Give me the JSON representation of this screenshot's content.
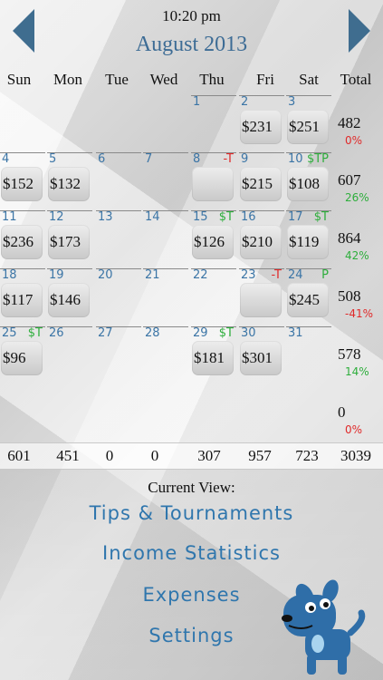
{
  "header": {
    "time": "10:20 pm",
    "month": "August 2013"
  },
  "weekdays": [
    "Sun",
    "Mon",
    "Tue",
    "Wed",
    "Thu",
    "Fri",
    "Sat",
    "Total"
  ],
  "weeks": [
    {
      "days": [
        {
          "day": "",
          "amount": "",
          "flag": "",
          "hasBox": false
        },
        {
          "day": "",
          "amount": "",
          "flag": "",
          "hasBox": false
        },
        {
          "day": "",
          "amount": "",
          "flag": "",
          "hasBox": false
        },
        {
          "day": "",
          "amount": "",
          "flag": "",
          "hasBox": false
        },
        {
          "day": "1",
          "amount": "",
          "flag": "",
          "hasBox": false
        },
        {
          "day": "2",
          "amount": "$231",
          "flag": "",
          "hasBox": true
        },
        {
          "day": "3",
          "amount": "$251",
          "flag": "",
          "hasBox": true
        }
      ],
      "total": "482",
      "pct": "0%",
      "pctColor": "#e02a2a"
    },
    {
      "days": [
        {
          "day": "4",
          "amount": "$152",
          "flag": "",
          "hasBox": true
        },
        {
          "day": "5",
          "amount": "$132",
          "flag": "",
          "hasBox": true
        },
        {
          "day": "6",
          "amount": "",
          "flag": "",
          "hasBox": false
        },
        {
          "day": "7",
          "amount": "",
          "flag": "",
          "hasBox": false
        },
        {
          "day": "8",
          "amount": "",
          "flag": "-T",
          "flagColor": "#e02a2a",
          "hasBox": true
        },
        {
          "day": "9",
          "amount": "$215",
          "flag": "",
          "hasBox": true
        },
        {
          "day": "10",
          "amount": "$108",
          "flag": "$TP",
          "flagColor": "#2eae3c",
          "hasBox": true
        }
      ],
      "total": "607",
      "pct": "26%",
      "pctColor": "#2eae3c"
    },
    {
      "days": [
        {
          "day": "11",
          "amount": "$236",
          "flag": "",
          "hasBox": true
        },
        {
          "day": "12",
          "amount": "$173",
          "flag": "",
          "hasBox": true
        },
        {
          "day": "13",
          "amount": "",
          "flag": "",
          "hasBox": false
        },
        {
          "day": "14",
          "amount": "",
          "flag": "",
          "hasBox": false
        },
        {
          "day": "15",
          "amount": "$126",
          "flag": "$T",
          "flagColor": "#2eae3c",
          "hasBox": true
        },
        {
          "day": "16",
          "amount": "$210",
          "flag": "",
          "hasBox": true
        },
        {
          "day": "17",
          "amount": "$119",
          "flag": "$T",
          "flagColor": "#2eae3c",
          "hasBox": true
        }
      ],
      "total": "864",
      "pct": "42%",
      "pctColor": "#2eae3c"
    },
    {
      "days": [
        {
          "day": "18",
          "amount": "$117",
          "flag": "",
          "hasBox": true
        },
        {
          "day": "19",
          "amount": "$146",
          "flag": "",
          "hasBox": true
        },
        {
          "day": "20",
          "amount": "",
          "flag": "",
          "hasBox": false
        },
        {
          "day": "21",
          "amount": "",
          "flag": "",
          "hasBox": false
        },
        {
          "day": "22",
          "amount": "",
          "flag": "",
          "hasBox": false
        },
        {
          "day": "23",
          "amount": "",
          "flag": "-T",
          "flagColor": "#e02a2a",
          "hasBox": true
        },
        {
          "day": "24",
          "amount": "$245",
          "flag": "P",
          "flagColor": "#2eae3c",
          "hasBox": true
        }
      ],
      "total": "508",
      "pct": "-41%",
      "pctColor": "#e02a2a"
    },
    {
      "days": [
        {
          "day": "25",
          "amount": "$96",
          "flag": "$T",
          "flagColor": "#2eae3c",
          "hasBox": true
        },
        {
          "day": "26",
          "amount": "",
          "flag": "",
          "hasBox": false
        },
        {
          "day": "27",
          "amount": "",
          "flag": "",
          "hasBox": false
        },
        {
          "day": "28",
          "amount": "",
          "flag": "",
          "hasBox": false
        },
        {
          "day": "29",
          "amount": "$181",
          "flag": "$T",
          "flagColor": "#2eae3c",
          "hasBox": true
        },
        {
          "day": "30",
          "amount": "$301",
          "flag": "",
          "hasBox": true
        },
        {
          "day": "31",
          "amount": "",
          "flag": "",
          "hasBox": false
        }
      ],
      "total": "578",
      "pct": "14%",
      "pctColor": "#2eae3c"
    },
    {
      "days": [
        {
          "day": "",
          "amount": "",
          "flag": "",
          "hasBox": false
        },
        {
          "day": "",
          "amount": "",
          "flag": "",
          "hasBox": false
        },
        {
          "day": "",
          "amount": "",
          "flag": "",
          "hasBox": false
        },
        {
          "day": "",
          "amount": "",
          "flag": "",
          "hasBox": false
        },
        {
          "day": "",
          "amount": "",
          "flag": "",
          "hasBox": false
        },
        {
          "day": "",
          "amount": "",
          "flag": "",
          "hasBox": false
        },
        {
          "day": "",
          "amount": "",
          "flag": "",
          "hasBox": false
        }
      ],
      "total": "0",
      "pct": "0%",
      "pctColor": "#e02a2a"
    }
  ],
  "column_totals": [
    "601",
    "451",
    "0",
    "0",
    "307",
    "957",
    "723",
    "3039"
  ],
  "bottom": {
    "current_view_label": "Current View:",
    "menu": [
      "Tips & Tournaments",
      "Income Statistics",
      "Expenses",
      "Settings"
    ]
  },
  "colors": {
    "accent": "#3d6c95",
    "link": "#2f76ad",
    "positive": "#2eae3c",
    "negative": "#e02a2a",
    "mascot": "#2f6ea8"
  },
  "icons": {
    "prev": "chevron-left-icon",
    "next": "chevron-right-icon",
    "mascot": "dog-mascot-icon"
  }
}
